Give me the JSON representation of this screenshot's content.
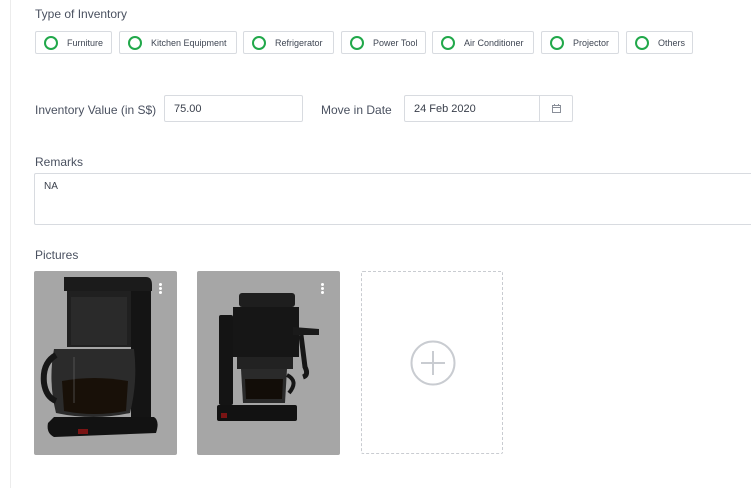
{
  "inventory_type": {
    "label": "Type of Inventory",
    "options": [
      "Furniture",
      "Kitchen Equipment",
      "Refrigerator",
      "Power Tool",
      "Air Conditioner",
      "Projector",
      "Others"
    ]
  },
  "inventory_value": {
    "label": "Inventory Value (in S$)",
    "value": "75.00"
  },
  "move_in_date": {
    "label": "Move in Date",
    "value": "24 Feb 2020",
    "icon": "calendar-icon"
  },
  "remarks": {
    "label": "Remarks",
    "value": "NA"
  },
  "pictures": {
    "label": "Pictures",
    "items": [
      {
        "name": "coffee-maker-drip-photo",
        "menu_icon": "more-vertical-icon"
      },
      {
        "name": "espresso-machine-photo",
        "menu_icon": "more-vertical-icon"
      }
    ],
    "add_icon": "plus-circle-icon"
  },
  "colors": {
    "radio_accent": "#21a84a",
    "border": "#d8dbe0",
    "photo_bg": "#a6a6a6"
  }
}
